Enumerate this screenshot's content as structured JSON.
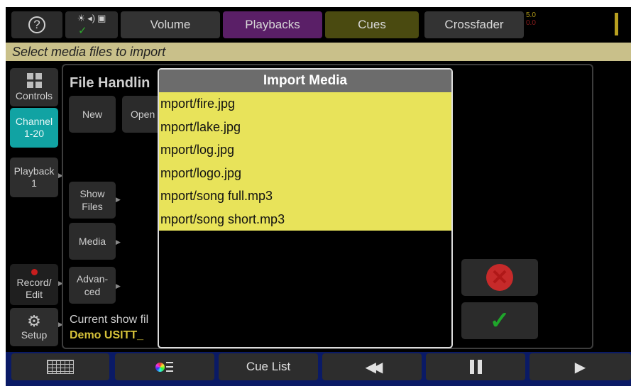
{
  "topbar": {
    "help_glyph": "?",
    "status_icons": "☀ ◂) ▣ ✓",
    "volume_label": "Volume",
    "playbacks_label": "Playbacks",
    "cues_label": "Cues",
    "crossfader_label": "Crossfader",
    "level_top": "5.0",
    "level_bottom": "0.0"
  },
  "prompt": "Select media files to import",
  "sidebar": {
    "controls": "Controls",
    "channel_line1": "Channel",
    "channel_line2": "1-20",
    "playback_line1": "Playback",
    "playback_line2": "1",
    "record_line1": "Record/",
    "record_line2": "Edit",
    "setup": "Setup"
  },
  "file_handling": {
    "title": "File Handlin",
    "new": "New",
    "open": "Open",
    "show_files_line1": "Show",
    "show_files_line2": "Files",
    "media": "Media",
    "advanced_line1": "Advan-",
    "advanced_line2": "ced",
    "current_label": "Current show fil",
    "current_name": "Demo USITT_"
  },
  "modal": {
    "title": "Import Media",
    "files": [
      "mport/fire.jpg",
      "mport/lake.jpg",
      "mport/log.jpg",
      "mport/logo.jpg",
      "mport/song full.mp3",
      "mport/song short.mp3"
    ]
  },
  "actions": {
    "cancel_glyph": "✕",
    "ok_glyph": "✓"
  },
  "bottombar": {
    "cue_list": "Cue List"
  },
  "colors": {
    "prompt_bg": "#c9c08a",
    "file_highlight": "#e8e35a",
    "playbacks_bg": "#5a1f67",
    "cues_bg": "#4a4a10",
    "channel_bg": "#11a3a3",
    "bottombar_bg": "#0a1a66"
  },
  "icons": [
    "help-icon",
    "brightness-icon",
    "volume-icon",
    "image-icon",
    "check-icon",
    "grid-icon",
    "color-picker-icon",
    "rewind-icon",
    "pause-icon",
    "play-icon",
    "gear-icon",
    "record-dot-icon",
    "cancel-icon",
    "ok-check-icon"
  ]
}
